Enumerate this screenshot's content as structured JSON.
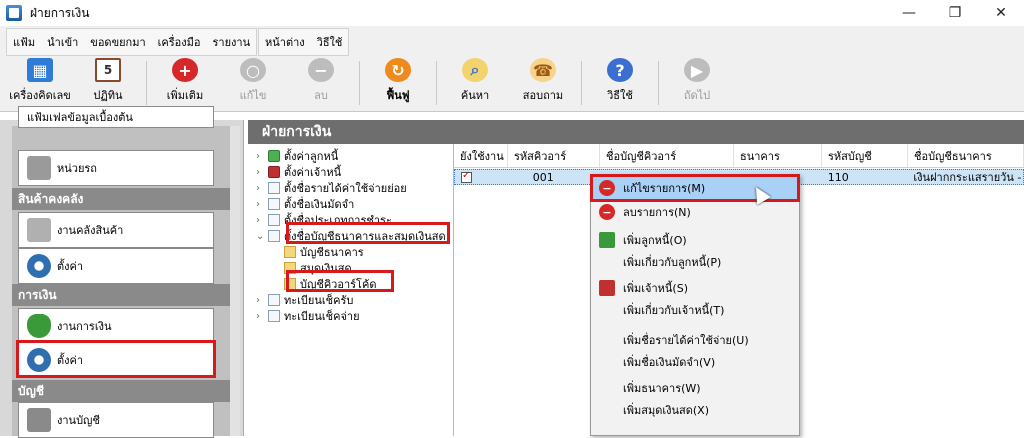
{
  "window": {
    "title": "ฝ่ายการเงิน",
    "min": "—",
    "max": "❐",
    "close": "✕"
  },
  "menu": {
    "group1": [
      "แฟ้ม",
      "นำเข้า",
      "ขอดขยกมา",
      "เครื่องมือ",
      "รายงาน"
    ],
    "group2": [
      "หน้าต่าง",
      "วิธีใช้"
    ]
  },
  "toolbar": [
    {
      "label": "เครื่องคิดเลข",
      "icon": "calculator-icon",
      "color": "#2f7bd6",
      "enabled": true
    },
    {
      "label": "ปฏิทิน",
      "icon": "calendar-icon",
      "color": "#8a4a2a",
      "enabled": true
    },
    {
      "label": "เพิ่มเติม",
      "icon": "add-icon",
      "color": "#d62828",
      "enabled": true
    },
    {
      "label": "แก้ไข",
      "icon": "edit-icon",
      "color": "#a9a9a9",
      "enabled": false
    },
    {
      "label": "ลบ",
      "icon": "delete-icon",
      "color": "#a9a9a9",
      "enabled": false
    },
    {
      "label": "ฟื้นฟู",
      "icon": "refresh-icon",
      "color": "#f08a1c",
      "enabled": true
    },
    {
      "label": "ค้นหา",
      "icon": "search-icon",
      "color": "#e8b320",
      "enabled": true
    },
    {
      "label": "สอบถาม",
      "icon": "phone-icon",
      "color": "#e0a030",
      "enabled": true
    },
    {
      "label": "วิธีใช้",
      "icon": "help-icon",
      "color": "#3a6fd0",
      "enabled": true
    },
    {
      "label": "ถัดไป",
      "icon": "next-icon",
      "color": "#a9a9a9",
      "enabled": false
    }
  ],
  "sidebar": {
    "partial_top": "แฟ้มเฟลข้อมูลเบื้องต้น",
    "vehicle": "หน่วยรถ",
    "cat_inventory": "สินค้าคงคลัง",
    "inventory_item": "งานคลังสินค้า",
    "inventory_settings": "ตั้งค่า",
    "cat_finance": "การเงิน",
    "finance_item": "งานการเงิน",
    "finance_settings": "ตั้งค่า",
    "cat_accounting": "บัญชี",
    "accounting_item": "งานบัญชี"
  },
  "main": {
    "header": "ฝ่ายการเงิน",
    "tree": [
      "ตั้งค่าลูกหนี้",
      "ตั้งค่าเจ้าหนี้",
      "ตั้งชื่อรายได้ค่าใช้จ่ายย่อย",
      "ตั้งชื่อเงินมัดจำ",
      "ตั้งชื่อประเภทการชำระ",
      "ตั้งชื่อบัญชีธนาคารและสมุดเงินสด",
      "บัญชีธนาคาร",
      "สมุดเงินสด",
      "บัญชีคิวอาร์โค้ด",
      "ทะเบียนเช็ครับ",
      "ทะเบียนเช็คจ่าย"
    ],
    "columns": [
      "ยังใช้งาน",
      "รหัสคิวอาร์",
      "ชื่อบัญชีคิวอาร์",
      "ธนาคาร",
      "รหัสบัญชี",
      "ชื่อบัญชีธนาคาร"
    ],
    "row": {
      "code": "001",
      "name": "",
      "bank": "",
      "account_code": "110",
      "account_name": "เงินฝากกระแสรายวัน -"
    }
  },
  "context_menu": [
    {
      "label": "แก้ไขรายการ(M)",
      "icon": "edit-record-icon",
      "color": "#d62828"
    },
    {
      "label": "ลบรายการ(N)",
      "icon": "delete-record-icon",
      "color": "#d62828"
    },
    {
      "label": "เพิ่มลูกหนี้(O)",
      "icon": "add-debtor-icon",
      "color": "#3a9a3a"
    },
    {
      "label": "เพิ่มเกี่ยวกับลูกหนี้(P)",
      "icon": "",
      "color": ""
    },
    {
      "label": "เพิ่มเจ้าหนี้(S)",
      "icon": "add-creditor-icon",
      "color": "#c03030"
    },
    {
      "label": "เพิ่มเกี่ยวกับเจ้าหนี้(T)",
      "icon": "",
      "color": ""
    },
    {
      "label": "เพิ่มชื่อรายได้ค่าใช้จ่าย(U)",
      "icon": "",
      "color": ""
    },
    {
      "label": "เพิ่มชื่อเงินมัดจำ(V)",
      "icon": "",
      "color": ""
    },
    {
      "label": "เพิ่มธนาคาร(W)",
      "icon": "",
      "color": ""
    },
    {
      "label": "เพิ่มสมุดเงินสด(X)",
      "icon": "",
      "color": ""
    }
  ],
  "colors": {
    "highlight": "#d7191c",
    "selection": "#a9d0f5",
    "category_bg": "#8a8a8a"
  }
}
